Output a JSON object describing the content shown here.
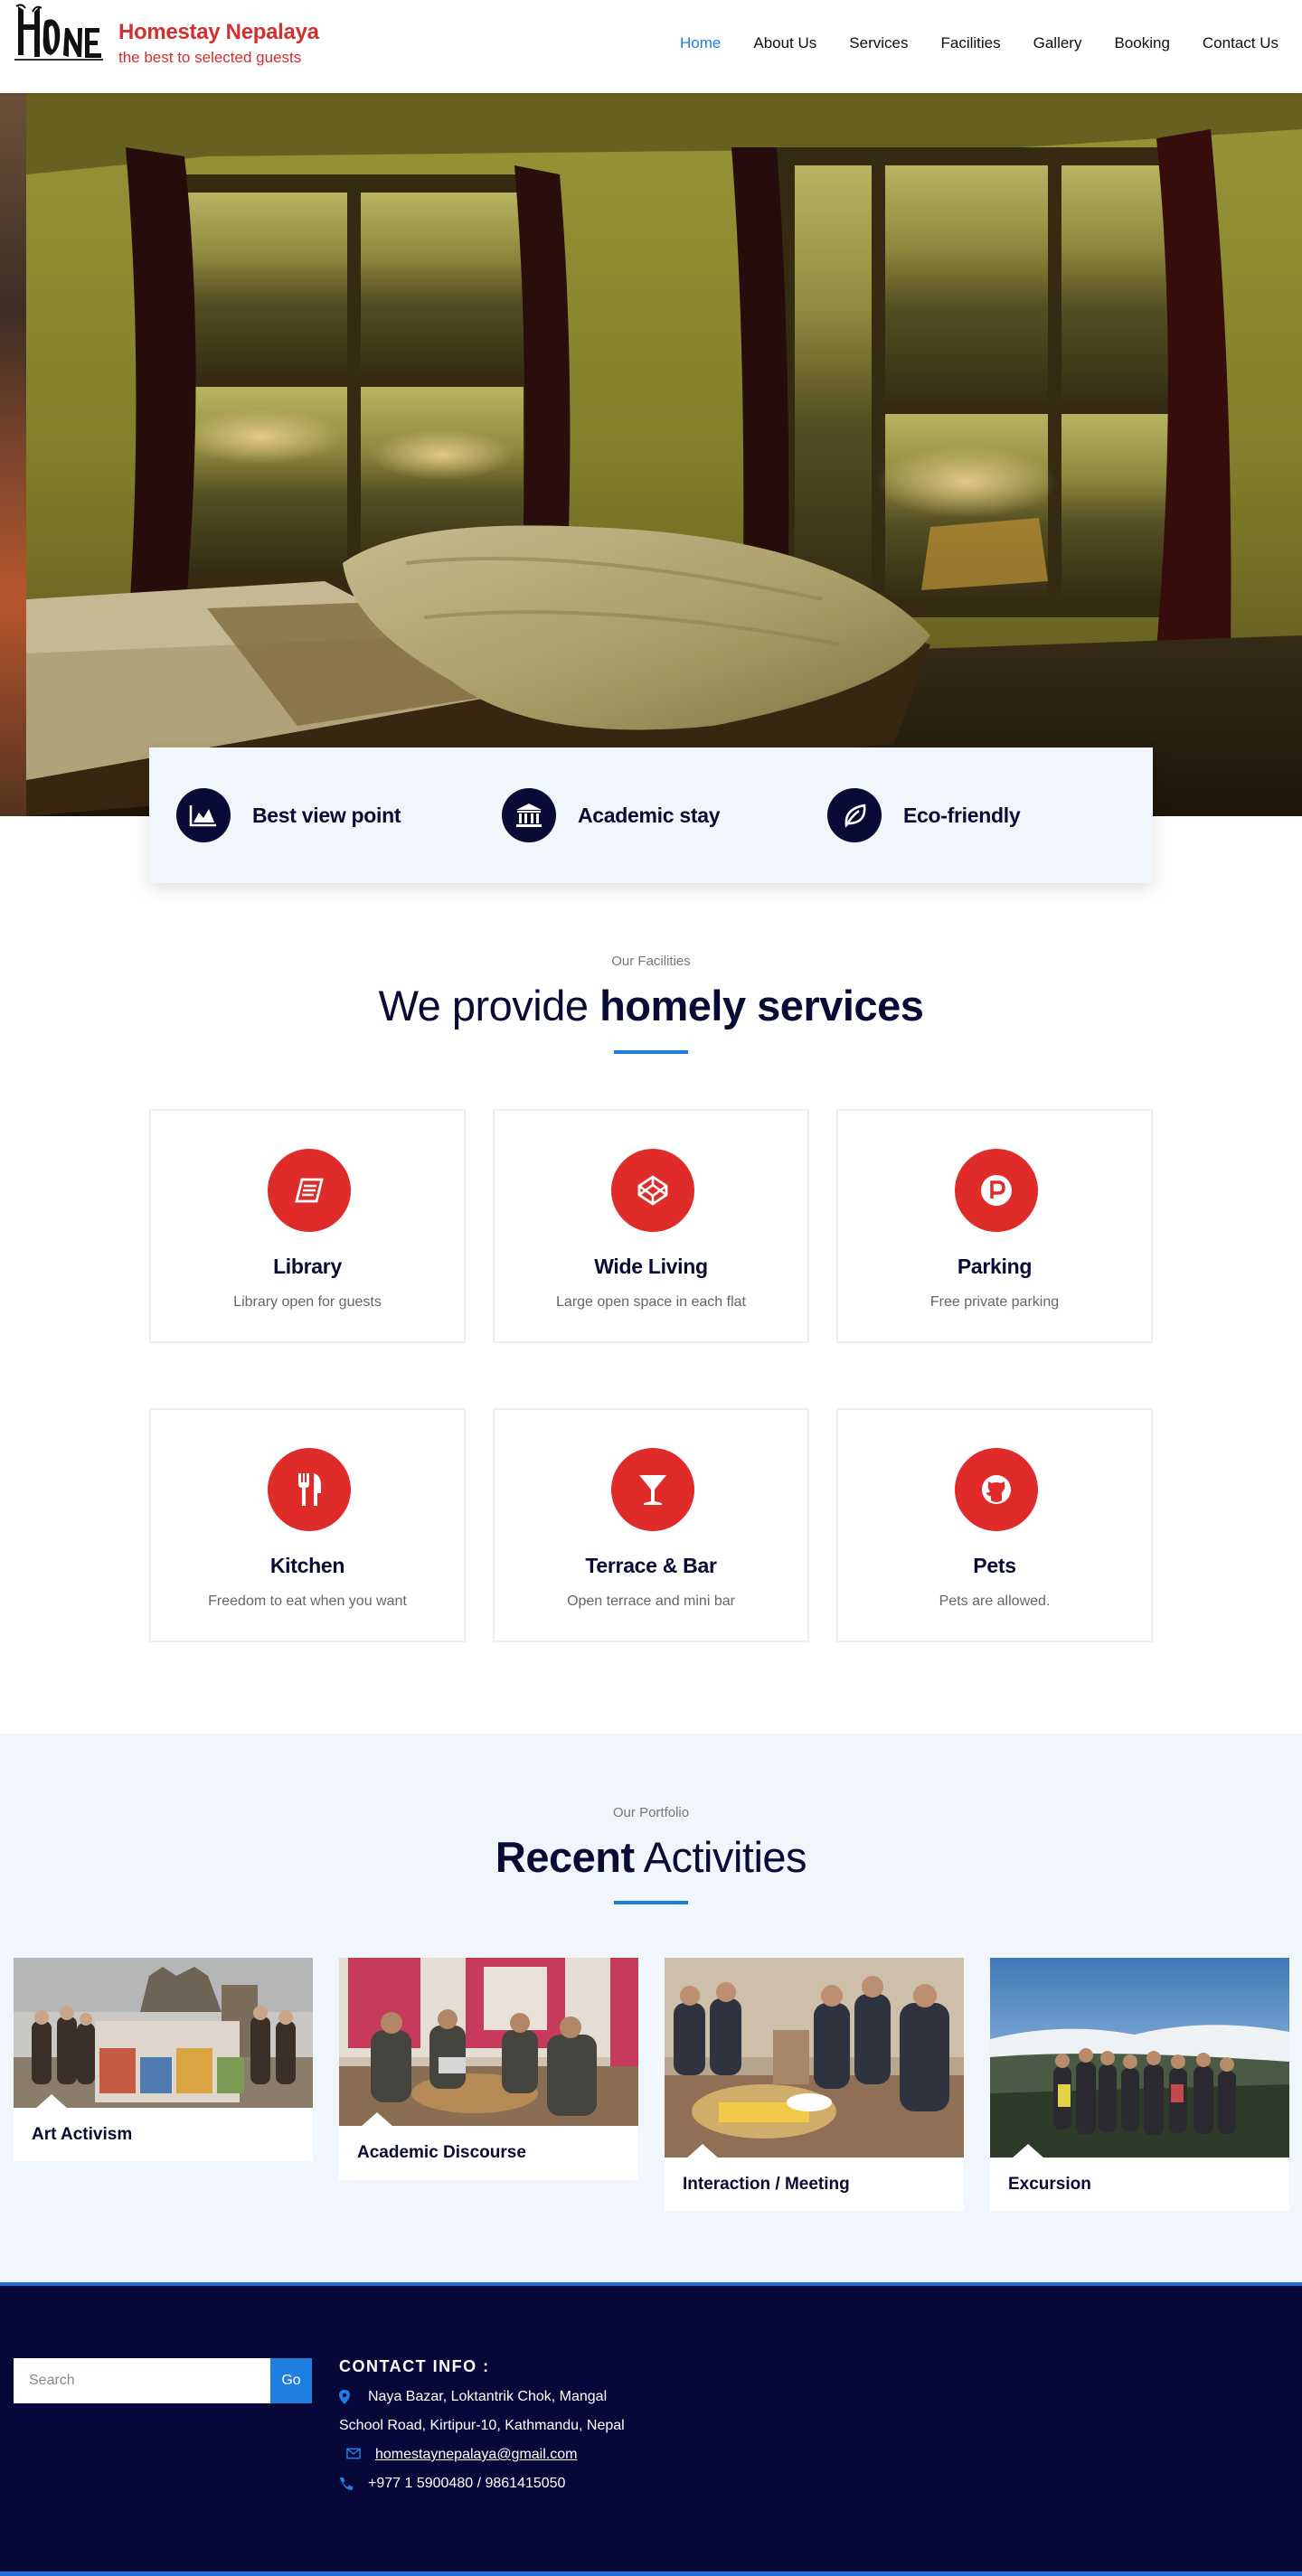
{
  "brand": {
    "name": "Homestay Nepalaya",
    "tagline": "the best to selected guests",
    "logo_text": "HOME"
  },
  "nav": {
    "items": [
      {
        "label": "Home",
        "active": true
      },
      {
        "label": "About Us",
        "active": false
      },
      {
        "label": "Services",
        "active": false
      },
      {
        "label": "Facilities",
        "active": false
      },
      {
        "label": "Gallery",
        "active": false
      },
      {
        "label": "Booking",
        "active": false
      },
      {
        "label": "Contact Us",
        "active": false
      }
    ]
  },
  "features": [
    {
      "label": "Best view point",
      "icon": "mountain-chart-icon"
    },
    {
      "label": "Academic stay",
      "icon": "university-icon"
    },
    {
      "label": "Eco-friendly",
      "icon": "leaf-icon"
    }
  ],
  "facilities": {
    "eyebrow": "Our Facilities",
    "title_light": "We provide ",
    "title_bold": "homely services",
    "items": [
      {
        "title": "Library",
        "desc": "Library open for guests",
        "icon": "book-icon"
      },
      {
        "title": "Wide Living",
        "desc": "Large open space in each flat",
        "icon": "codepen-icon"
      },
      {
        "title": "Parking",
        "desc": "Free private parking",
        "icon": "parking-icon"
      },
      {
        "title": "Kitchen",
        "desc": "Freedom to eat when you want",
        "icon": "utensils-icon"
      },
      {
        "title": "Terrace & Bar",
        "desc": "Open terrace and mini bar",
        "icon": "cocktail-icon"
      },
      {
        "title": "Pets",
        "desc": "Pets are allowed.",
        "icon": "github-cat-icon"
      }
    ]
  },
  "portfolio": {
    "eyebrow": "Our Portfolio",
    "title_bold": "Recent",
    "title_light": " Activities",
    "items": [
      {
        "label": "Art Activism"
      },
      {
        "label": "Academic Discourse"
      },
      {
        "label": "Interaction / Meeting"
      },
      {
        "label": "Excursion"
      }
    ]
  },
  "footer": {
    "search_placeholder": "Search",
    "search_button": "Go",
    "contact_heading": "CONTACT INFO :",
    "address_line1": "Naya Bazar, Loktantrik Chok, Mangal",
    "address_line2": "School Road, Kirtipur-10, Kathmandu, Nepal",
    "email": "homestaynepalaya@gmail.com",
    "phone": "+977 1 5900480 / 9861415050"
  },
  "colors": {
    "brand_red": "#d32f2f",
    "accent_blue": "#1e7fe0",
    "navy": "#0a0a36",
    "icon_red": "#e02b2b",
    "light_bg": "#f1f6fc"
  }
}
